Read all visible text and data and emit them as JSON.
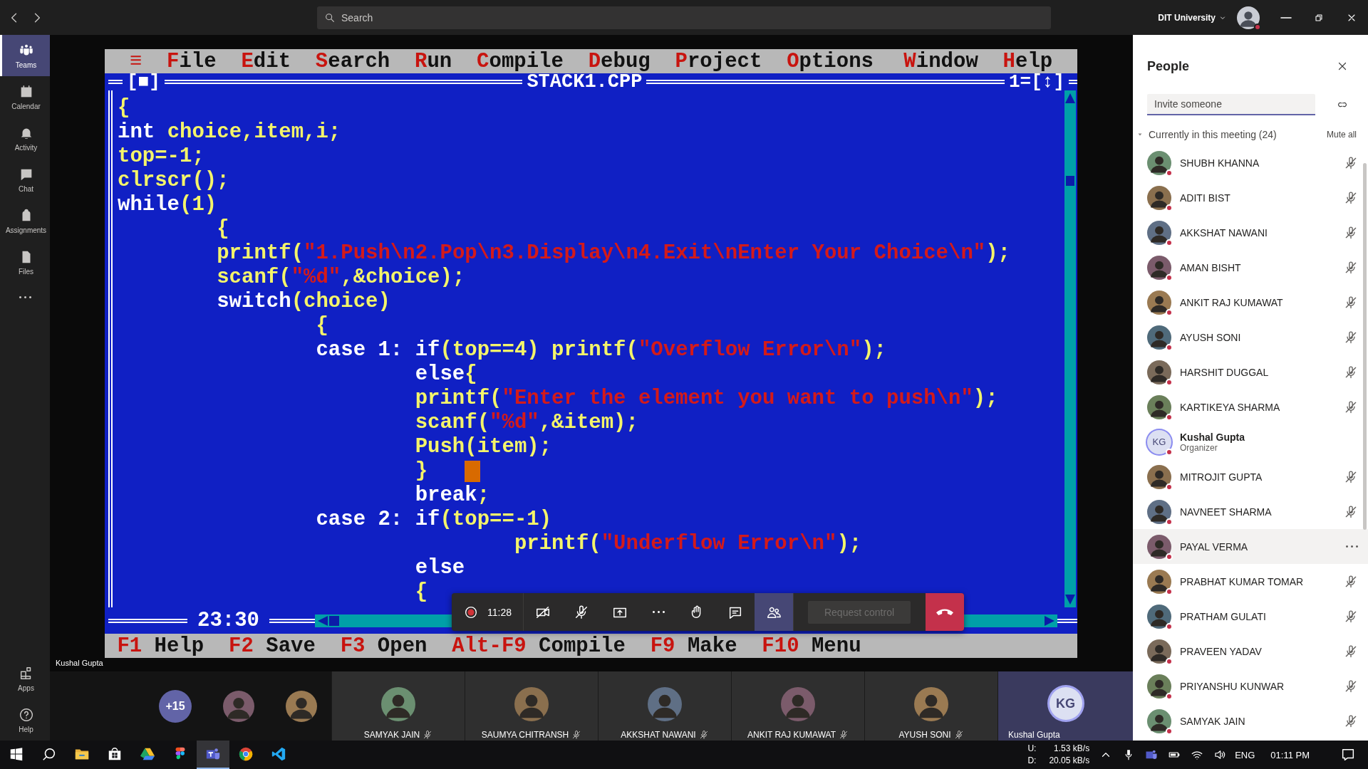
{
  "title_bar": {
    "search": {
      "placeholder": "Search"
    },
    "organization": "DIT University"
  },
  "rail": {
    "items": [
      {
        "label": "Teams",
        "kind": "teams",
        "selected": true
      },
      {
        "label": "Calendar",
        "kind": "calendar",
        "selected": false
      },
      {
        "label": "Activity",
        "kind": "activity",
        "selected": false
      },
      {
        "label": "Chat",
        "kind": "chat",
        "selected": false
      },
      {
        "label": "Assignments",
        "kind": "assignments",
        "selected": false
      },
      {
        "label": "Files",
        "kind": "files",
        "selected": false
      }
    ],
    "bottom_items": [
      {
        "label": "Apps",
        "kind": "apps"
      },
      {
        "label": "Help",
        "kind": "help"
      }
    ]
  },
  "shared_screen": {
    "menu_left": [
      "≡",
      "File",
      "Edit",
      "Search",
      "Run",
      "Compile",
      "Debug",
      "Project",
      "Options"
    ],
    "menu_right": [
      "Window",
      "Help"
    ],
    "close_box": "[■]",
    "window_title": "STACK1.CPP",
    "window_number": "1=[↕]",
    "cursor_position": "23:30",
    "code": [
      {
        "cursor": false,
        "tokens": [
          {
            "kind": "id",
            "text": "{"
          }
        ]
      },
      {
        "cursor": false,
        "tokens": [
          {
            "kind": "kw",
            "text": "int "
          },
          {
            "kind": "id",
            "text": "choice,item,i;"
          }
        ]
      },
      {
        "cursor": false,
        "tokens": [
          {
            "kind": "id",
            "text": "top=-1;"
          }
        ]
      },
      {
        "cursor": false,
        "tokens": [
          {
            "kind": "id",
            "text": "clrscr();"
          }
        ]
      },
      {
        "cursor": false,
        "tokens": [
          {
            "kind": "kw",
            "text": "while"
          },
          {
            "kind": "id",
            "text": "(1)"
          }
        ]
      },
      {
        "cursor": false,
        "tokens": [
          {
            "kind": "id",
            "text": "        {"
          }
        ]
      },
      {
        "cursor": false,
        "tokens": [
          {
            "kind": "id",
            "text": "        printf("
          },
          {
            "kind": "str",
            "text": "\"1.Push\\n2.Pop\\n3.Display\\n4.Exit\\nEnter Your Choice\\n\""
          },
          {
            "kind": "id",
            "text": ");"
          }
        ]
      },
      {
        "cursor": false,
        "tokens": [
          {
            "kind": "id",
            "text": "        scanf("
          },
          {
            "kind": "str",
            "text": "\"%d\""
          },
          {
            "kind": "id",
            "text": ",&choice);"
          }
        ]
      },
      {
        "cursor": false,
        "tokens": [
          {
            "kind": "kw",
            "text": "        switch"
          },
          {
            "kind": "id",
            "text": "(choice)"
          }
        ]
      },
      {
        "cursor": false,
        "tokens": [
          {
            "kind": "id",
            "text": "                {"
          }
        ]
      },
      {
        "cursor": false,
        "tokens": [
          {
            "kind": "kw",
            "text": "                case 1: if"
          },
          {
            "kind": "id",
            "text": "(top==4) printf("
          },
          {
            "kind": "str",
            "text": "\"Overflow Error\\n\""
          },
          {
            "kind": "id",
            "text": ");"
          }
        ]
      },
      {
        "cursor": false,
        "tokens": [
          {
            "kind": "kw",
            "text": "                        else"
          },
          {
            "kind": "id",
            "text": "{"
          }
        ]
      },
      {
        "cursor": false,
        "tokens": [
          {
            "kind": "id",
            "text": "                        printf("
          },
          {
            "kind": "str",
            "text": "\"Enter the element you want to push\\n\""
          },
          {
            "kind": "id",
            "text": ");"
          }
        ]
      },
      {
        "cursor": false,
        "tokens": [
          {
            "kind": "id",
            "text": "                        scanf("
          },
          {
            "kind": "str",
            "text": "\"%d\""
          },
          {
            "kind": "id",
            "text": ",&item);"
          }
        ]
      },
      {
        "cursor": false,
        "tokens": [
          {
            "kind": "id",
            "text": "                        Push(item);"
          }
        ]
      },
      {
        "cursor": true,
        "tokens": [
          {
            "kind": "id",
            "text": "                        }"
          }
        ]
      },
      {
        "cursor": false,
        "tokens": [
          {
            "kind": "kw",
            "text": "                        break"
          },
          {
            "kind": "id",
            "text": ";"
          }
        ]
      },
      {
        "cursor": false,
        "tokens": [
          {
            "kind": "kw",
            "text": "                case 2: if"
          },
          {
            "kind": "id",
            "text": "(top==-1)"
          }
        ]
      },
      {
        "cursor": false,
        "tokens": [
          {
            "kind": "id",
            "text": "                                printf("
          },
          {
            "kind": "str",
            "text": "\"Underflow Error\\n\""
          },
          {
            "kind": "id",
            "text": ");"
          }
        ]
      },
      {
        "cursor": false,
        "tokens": [
          {
            "kind": "kw",
            "text": "                        else"
          }
        ]
      },
      {
        "cursor": false,
        "tokens": [
          {
            "kind": "id",
            "text": "                        {"
          }
        ]
      }
    ],
    "shortcuts": [
      {
        "key": "F1",
        "label": "Help"
      },
      {
        "key": "F2",
        "label": "Save"
      },
      {
        "key": "F3",
        "label": "Open"
      },
      {
        "key": "Alt-F9",
        "label": "Compile"
      },
      {
        "key": "F9",
        "label": "Make"
      },
      {
        "key": "F10",
        "label": "Menu"
      }
    ]
  },
  "presenter_label": "Kushal Gupta",
  "call_controls": {
    "timer": "11:28",
    "buttons": [
      {
        "kind": "camera",
        "selected": false
      },
      {
        "kind": "mic",
        "selected": false
      },
      {
        "kind": "share",
        "selected": false
      },
      {
        "kind": "more",
        "selected": false
      },
      {
        "kind": "hand",
        "selected": false
      },
      {
        "kind": "chat",
        "selected": false
      },
      {
        "kind": "people",
        "selected": true
      }
    ],
    "request_control": {
      "label": "Request control",
      "disabled": true
    }
  },
  "gallery": {
    "overflow": "+15",
    "tiles": [
      {
        "name": "SAMYAK JAIN",
        "kind": "video",
        "muted": true,
        "highlighted": false
      },
      {
        "name": "SAUMYA CHITRANSH",
        "kind": "video",
        "muted": true,
        "highlighted": false
      },
      {
        "name": "AKKSHAT NAWANI",
        "kind": "video",
        "muted": true,
        "highlighted": false
      },
      {
        "name": "ANKIT RAJ KUMAWAT",
        "kind": "video",
        "muted": true,
        "highlighted": false
      },
      {
        "name": "AYUSH SONI",
        "kind": "video",
        "muted": true,
        "highlighted": false
      },
      {
        "name": "Kushal Gupta",
        "kind": "initials",
        "initials": "KG",
        "muted": false,
        "highlighted": true
      }
    ]
  },
  "people_panel": {
    "title": "People",
    "invite_placeholder": "Invite someone",
    "section": {
      "label": "Currently in this meeting (24)",
      "expanded": true
    },
    "mute_all": "Mute all",
    "participants": [
      {
        "name": "SHUBH KHANNA",
        "kind": "member",
        "muted": true,
        "hovered": false
      },
      {
        "name": "ADITI BIST",
        "kind": "member",
        "muted": true,
        "hovered": false
      },
      {
        "name": "AKKSHAT NAWANI",
        "kind": "member",
        "muted": true,
        "hovered": false
      },
      {
        "name": "AMAN BISHT",
        "kind": "member",
        "muted": true,
        "hovered": false
      },
      {
        "name": "ANKIT RAJ KUMAWAT",
        "kind": "member",
        "muted": true,
        "hovered": false
      },
      {
        "name": "AYUSH SONI",
        "kind": "member",
        "muted": true,
        "hovered": false
      },
      {
        "name": "HARSHIT DUGGAL",
        "kind": "member",
        "muted": true,
        "hovered": false
      },
      {
        "name": "KARTIKEYA SHARMA",
        "kind": "member",
        "muted": true,
        "hovered": false
      },
      {
        "name": "Kushal Gupta",
        "kind": "organizer",
        "initials": "KG",
        "role": "Organizer",
        "muted": false,
        "hovered": false
      },
      {
        "name": "MITROJIT GUPTA",
        "kind": "member",
        "muted": true,
        "hovered": false
      },
      {
        "name": "NAVNEET SHARMA",
        "kind": "member",
        "muted": true,
        "hovered": false
      },
      {
        "name": "PAYAL VERMA",
        "kind": "member",
        "hovered": true
      },
      {
        "name": "PRABHAT KUMAR TOMAR",
        "kind": "member",
        "muted": true,
        "hovered": false
      },
      {
        "name": "PRATHAM GULATI",
        "kind": "member",
        "muted": true,
        "hovered": false
      },
      {
        "name": "PRAVEEN YADAV",
        "kind": "member",
        "muted": true,
        "hovered": false
      },
      {
        "name": "PRIYANSHU KUNWAR",
        "kind": "member",
        "muted": true,
        "hovered": false
      },
      {
        "name": "SAMYAK JAIN",
        "kind": "member",
        "muted": true,
        "hovered": false
      }
    ]
  },
  "taskbar": {
    "apps": [
      {
        "kind": "start",
        "active": false
      },
      {
        "kind": "search",
        "active": false
      },
      {
        "kind": "explorer",
        "active": false
      },
      {
        "kind": "store",
        "active": false
      },
      {
        "kind": "drive",
        "active": false
      },
      {
        "kind": "figma",
        "active": false
      },
      {
        "kind": "teams",
        "active": true
      },
      {
        "kind": "chrome",
        "active": false
      },
      {
        "kind": "vscode",
        "active": false
      }
    ],
    "network": {
      "up_label": "U:",
      "up": "1.53 kB/s",
      "down_label": "D:",
      "down": "20.05 kB/s"
    },
    "language": "ENG",
    "time": "01:11 PM"
  }
}
